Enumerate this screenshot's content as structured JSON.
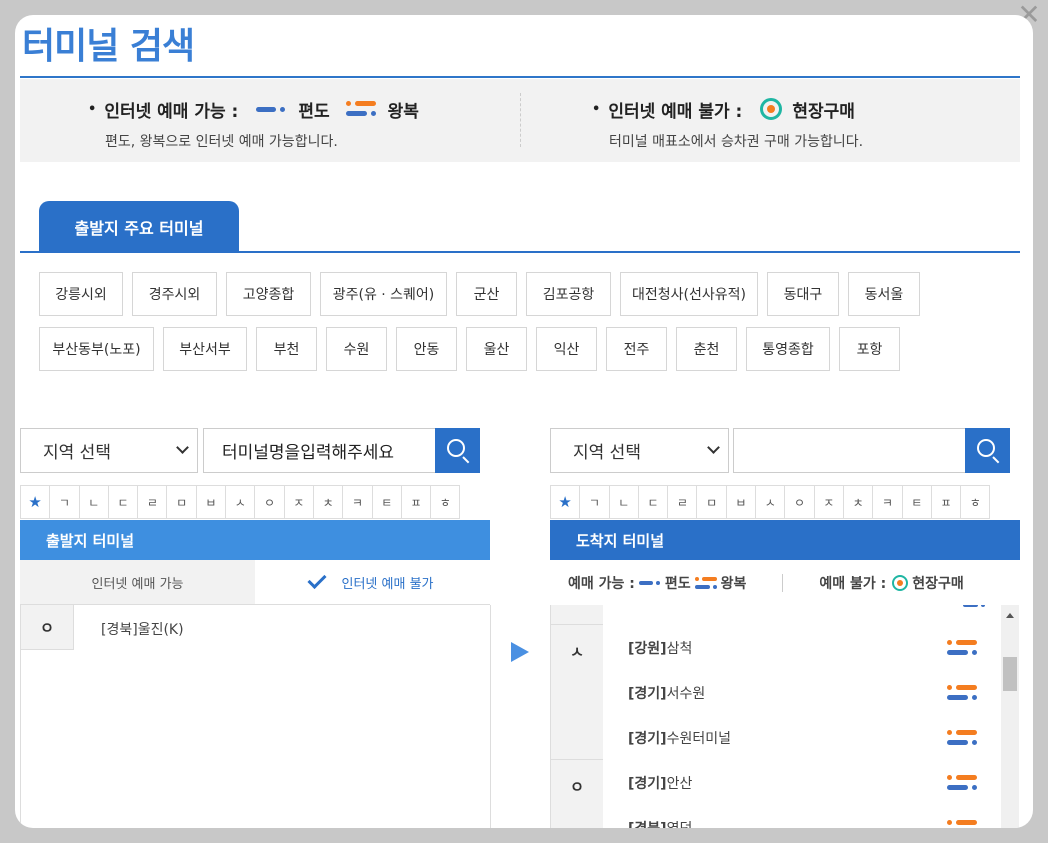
{
  "window": {
    "close_label": "✕"
  },
  "title": "터미널 검색",
  "info": {
    "available_label": "인터넷 예매 가능 :",
    "pyeondo": "편도",
    "wangbok": "왕복",
    "available_desc": "편도, 왕복으로 인터넷 예매 가능합니다.",
    "unavailable_label": "인터넷 예매 불가 :",
    "onsite": "현장구매",
    "unavailable_desc": "터미널 매표소에서 승차권 구매 가능합니다."
  },
  "major_tab": "출발지 주요 터미널",
  "major_terminals_row1": [
    "강릉시외",
    "경주시외",
    "고양종합",
    "광주(유 · 스퀘어)",
    "군산",
    "김포공항",
    "대전청사(선사유적)",
    "동대구",
    "동서울"
  ],
  "major_terminals_row2": [
    "부산동부(노포)",
    "부산서부",
    "부천",
    "수원",
    "안동",
    "울산",
    "익산",
    "전주",
    "춘천",
    "통영종합",
    "포항"
  ],
  "departure": {
    "region_select": "지역 선택",
    "search_value": "터미널명을입력해주세요",
    "panel_title": "출발지 터미널",
    "tab_available": "인터넷 예매 가능",
    "tab_unavailable": "인터넷 예매 불가",
    "index_letter": "ㅇ",
    "item_region": "[경북]",
    "item_name": "울진(K)"
  },
  "arrival": {
    "region_select": "지역 선택",
    "search_value": "",
    "panel_title": "도착지 터미널",
    "legend_available": "예매 가능 :",
    "legend_pyeondo": "편도",
    "legend_wangbok": "왕복",
    "legend_unavailable": "예매 불가 :",
    "legend_onsite": "현장구매",
    "index_s": "ㅅ",
    "index_o": "ㅇ",
    "rows": [
      {
        "region": "[강원]",
        "name": "삼척"
      },
      {
        "region": "[경기]",
        "name": "서수원"
      },
      {
        "region": "[경기]",
        "name": "수원터미널"
      },
      {
        "region": "[경기]",
        "name": "안산"
      },
      {
        "region": "[경북]",
        "name": "영덕"
      }
    ]
  },
  "consonants": [
    "★",
    "ㄱ",
    "ㄴ",
    "ㄷ",
    "ㄹ",
    "ㅁ",
    "ㅂ",
    "ㅅ",
    "ㅇ",
    "ㅈ",
    "ㅊ",
    "ㅋ",
    "ㅌ",
    "ㅍ",
    "ㅎ"
  ],
  "colors": {
    "primary": "#2a70c8",
    "title": "#3a7fd5",
    "orange": "#f47d20",
    "teal": "#1fb6a3"
  }
}
